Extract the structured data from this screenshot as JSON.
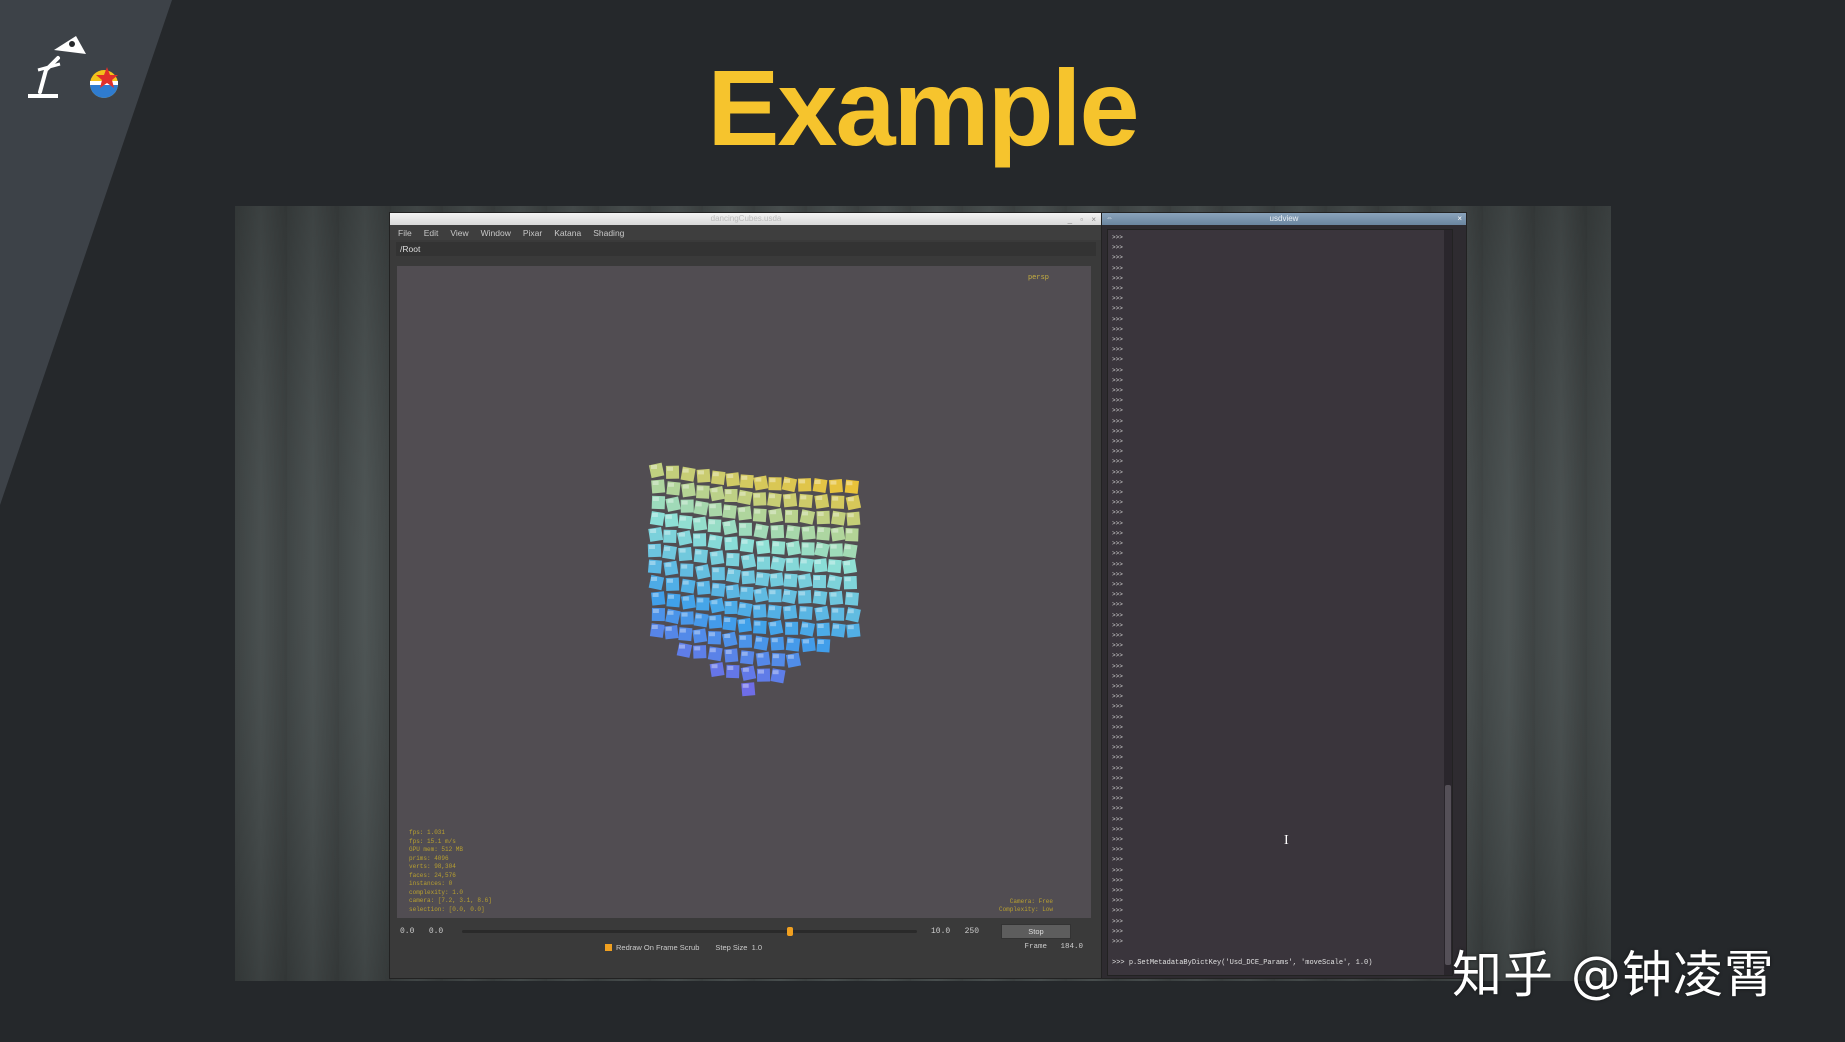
{
  "slide": {
    "title": "Example",
    "title_color": "#f6c42d",
    "background_color": "#25282b",
    "logo_icon": "pixar-lamp-with-luxo-ball-icon"
  },
  "katana_window": {
    "title": "dancingCubes.usda",
    "menu": [
      "File",
      "Edit",
      "View",
      "Window",
      "Pixar",
      "Katana",
      "Shading"
    ],
    "path": "/Root",
    "viewport": {
      "camera_label": "persp",
      "stats": [
        "fps: 1.031",
        "fps: 15.1 m/s",
        "GPU mem: 512 MB",
        "prims: 4096",
        "verts: 98,304",
        "faces: 24,576",
        "instances: 0",
        "complexity: 1.0",
        "camera: [7.2, 3.1, 8.6]",
        "selection: [0.0, 0.0]"
      ],
      "camera_info": [
        "Camera: Free",
        "Complexity: Low"
      ],
      "content_icon": "dancing-cubes-3d-render",
      "cube_colors": [
        "#e9c23a",
        "#8ee0d6",
        "#3fa0ea",
        "#7a5fe6"
      ]
    },
    "timeline": {
      "start": "0.0",
      "current_start": "0.0",
      "end_current": "10.0",
      "end": "250",
      "playhead_fraction": 0.715,
      "stop_label": "Stop",
      "redraw_label": "Redraw On Frame Scrub",
      "redraw_checked": true,
      "step_size_label": "Step Size",
      "step_size_value": "1.0",
      "frame_label": "Frame",
      "frame_value": "184.0"
    }
  },
  "python_window": {
    "title": "usdview",
    "prompt": ">>>",
    "prompt_count": 70,
    "last_command": "p.SetMetadataByDictKey('Usd_DCE_Params', 'moveScale', 1.0)"
  },
  "watermark": "知乎 @钟凌霄"
}
